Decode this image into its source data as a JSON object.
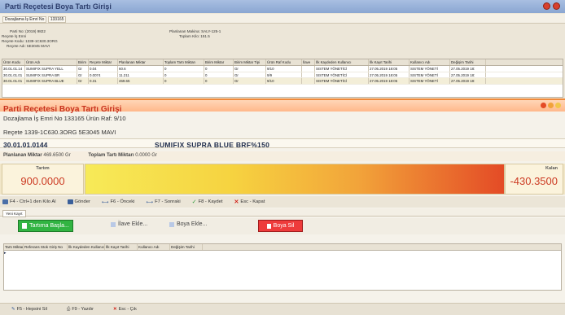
{
  "window": {
    "title": "Parti Reçetesi Boya Tartı Girişi"
  },
  "top_row": {
    "label": "Dozajlama İş Emri No",
    "value": "133165"
  },
  "info": {
    "parti_no": "Parti No: (2019) 9822",
    "recete_is_emri": "Reçete İş Emri",
    "recete_kodu": "Reçete Kodu: 1339-1C630.3ORG",
    "recete_adi": "Reçete Adı: 5E3045 MAVI",
    "planlanan_makina": "Planlanan Makina: SALY-125-1",
    "toplam_kilo": "Toplam Kilo: 151.5"
  },
  "grid1": {
    "headers": [
      "Ürün Kodu",
      "Ürün Adı",
      "Birim",
      "Reçete Miktar",
      "Planlanan Miktar",
      "Toplam Tartı Miktarı",
      "Birim Miktar",
      "Birim Miktar Tipi",
      "Ürün Raf Kodu",
      "İlave",
      "İlk Kaydeden Kullanıcı",
      "İlk Kayıt Tarihi",
      "Kullanıcı Adı",
      "Değişim Tarihi"
    ],
    "rows": [
      [
        "30.01.01.14",
        "SUMIFIX SUPRA YELL",
        "Gr",
        "0.04",
        "60.6",
        "0",
        "0",
        "Gr",
        "9/10",
        "",
        "SISTEM YÖNETİCİ",
        "27.05.2019 18:05",
        "SISTEM YÖNETİ",
        "27.05.2019 18:"
      ],
      [
        "30.01.01.01",
        "SUMIFIX SUPRA BR",
        "Gr",
        "0.0074",
        "11.211",
        "0",
        "0",
        "Gr",
        "9/9",
        "",
        "SISTEM YÖNETİCİ",
        "27.05.2019 18:05",
        "SISTEM YÖNETİ",
        "27.05.2019 18:"
      ],
      [
        "30.01.01.01",
        "SUMIFIX SUPRA BLUE",
        "Gr",
        "0.31",
        "469.65",
        "0",
        "0",
        "Gr",
        "9/10",
        "",
        "SISTEM YÖNETİCİ",
        "27.05.2019 18:05",
        "SISTEM YÖNETİ",
        "27.05.2019 18:"
      ]
    ]
  },
  "panel": {
    "title": "Parti Reçetesi Boya Tartı Girişi",
    "subtitle": "Dozajlama İş Emri No 133165   Ürün Raf: 9/10",
    "recete": "Reçete 1339-1C630.3ORG 5E3045 MAVI",
    "product_code": "30.01.01.0144",
    "product_name": "SUMIFIX SUPRA BLUE BRF%150",
    "planlanan_label": "Planlanan Miktar",
    "planlanan_value": "469.6500 Gr",
    "toplam_label": "Toplam Tartı Miktarı",
    "toplam_value": "0.0000 Gr",
    "tartim_label": "Tartım",
    "tartim_value": "900.0000",
    "kalan_label": "Kalan",
    "kalan_value": "-430.3500"
  },
  "toolbar": {
    "ctrl1": "F4 - Ctrl+1 den Kilo Al",
    "gonder": "Gönder",
    "onceki": "F6 - Önceki",
    "sonraki": "F7 - Sonraki",
    "kaydet": "F8 - Kaydet",
    "kapat": "Esc - Kapat"
  },
  "tab": {
    "label": "Yeni Kayıt"
  },
  "buttons": {
    "tartima_basla": "Tartıma Başla...",
    "ilave_ekle": "İlave Ekle...",
    "boya_ekle": "Boya Ekle...",
    "boya_sil": "Boya Sil"
  },
  "grid2": {
    "headers": [
      "Tartı Miktarı",
      "Referans Stok Giriş No",
      "İlk Kaydeden Kullanıcı",
      "İlk Kayıt Tarihi",
      "Kullanıcı Adı",
      "Değişim Tarihi"
    ]
  },
  "footer": {
    "hepsini_sil": "F5 - Hepsini Sil",
    "yazdir": "F9 - Yazdır",
    "cik": "Esc - Çık"
  },
  "colors": {
    "accent": "#c8321e",
    "title_bar": "#8aa6d2",
    "start_green": "#31b442",
    "delete_red": "#ee3b3b"
  }
}
